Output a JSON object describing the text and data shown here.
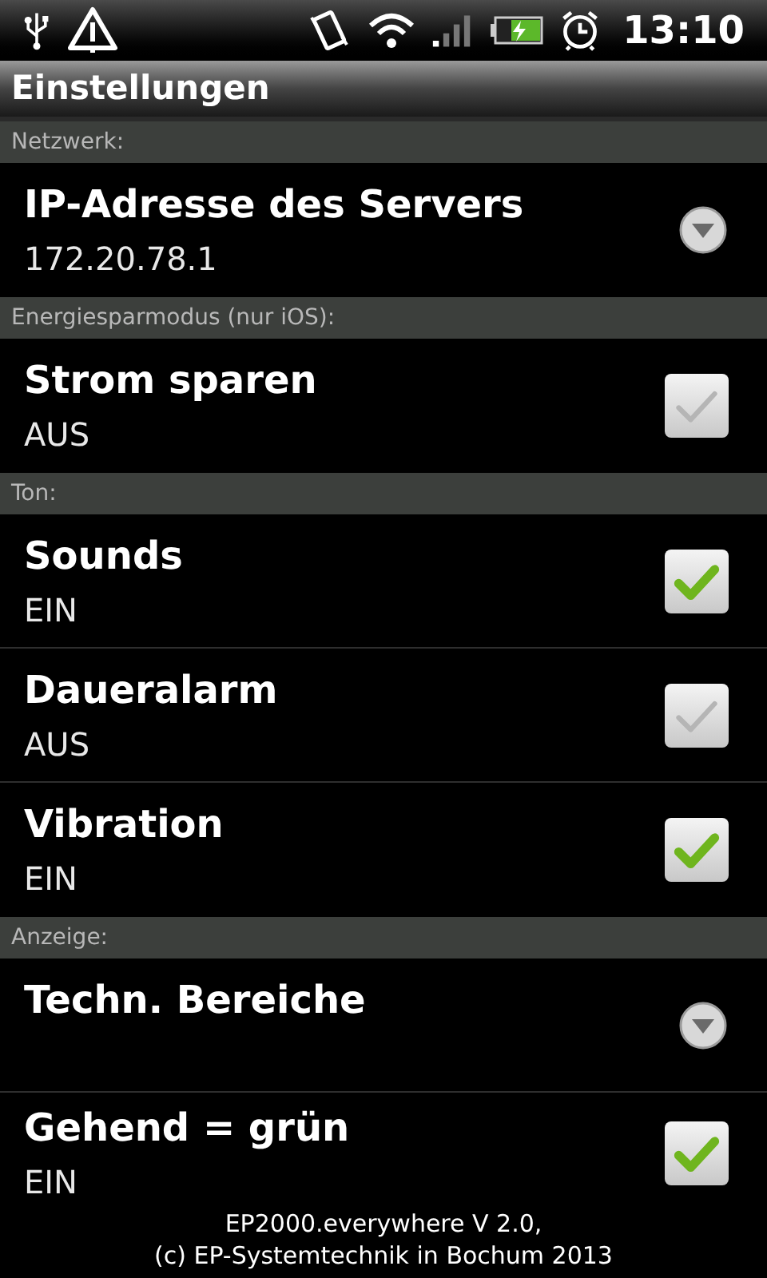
{
  "status_bar": {
    "time": "13:10"
  },
  "title": "Einstellungen",
  "sections": [
    {
      "header": "Netzwerk:",
      "items": [
        {
          "kind": "dropdown",
          "title": "IP-Adresse des Servers",
          "summary": "172.20.78.1"
        }
      ]
    },
    {
      "header": "Energiesparmodus (nur iOS):",
      "items": [
        {
          "kind": "checkbox",
          "title": "Strom sparen",
          "summary": "AUS",
          "checked": false
        }
      ]
    },
    {
      "header": "Ton:",
      "items": [
        {
          "kind": "checkbox",
          "title": "Sounds",
          "summary": "EIN",
          "checked": true
        },
        {
          "kind": "checkbox",
          "title": "Daueralarm",
          "summary": "AUS",
          "checked": false
        },
        {
          "kind": "checkbox",
          "title": "Vibration",
          "summary": "EIN",
          "checked": true
        }
      ]
    },
    {
      "header": "Anzeige:",
      "items": [
        {
          "kind": "dropdown",
          "title": "Techn. Bereiche"
        },
        {
          "kind": "checkbox",
          "title": "Gehend = grün",
          "summary": "EIN",
          "checked": true
        }
      ]
    }
  ],
  "footer": [
    "EP2000.everywhere V 2.0,",
    "(c) EP-Systemtechnik in Bochum 2013"
  ]
}
